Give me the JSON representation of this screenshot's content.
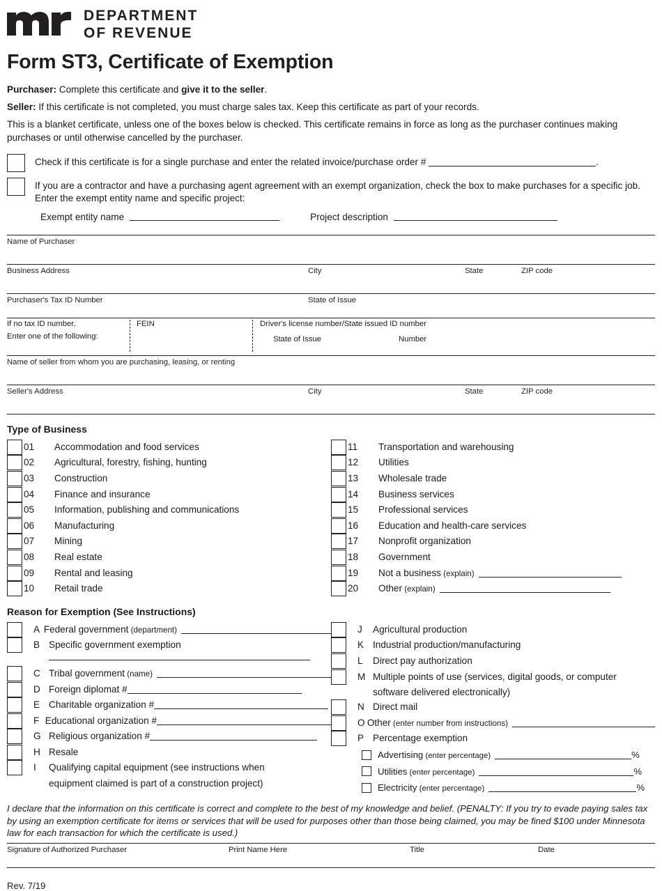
{
  "header": {
    "logo_icon": "mn-wordmark-logo",
    "dept_line1": "DEPARTMENT",
    "dept_line2": "OF REVENUE",
    "form_title": "Form ST3, Certificate of Exemption"
  },
  "intro": {
    "purchaser_label": "Purchaser:",
    "purchaser_text": " Complete this certificate and ",
    "purchaser_bold": "give it to the seller",
    "purchaser_end": ".",
    "seller_label": "Seller:",
    "seller_text": " If this certificate is not completed, you must charge sales tax. Keep this certificate as part of your records.",
    "blanket": "This is a blanket certificate, unless one of the boxes below is checked. This certificate remains in force as long as the purchaser continues making purchases or until otherwise cancelled by the purchaser."
  },
  "top_checks": {
    "single_purchase": "Check if this certificate is for a single purchase and enter the related invoice/purchase order #",
    "single_purchase_end": ".",
    "contractor": "If you are a contractor and have a purchasing agent agreement with an exempt organization, check the box to make purchases for a specific job. Enter the exempt entity name and specific project:",
    "exempt_entity_label": "Exempt entity name",
    "project_description_label": "Project description"
  },
  "fields": {
    "name_of_purchaser": "Name of Purchaser",
    "business_address": "Business Address",
    "city": "City",
    "state": "State",
    "zip_code": "ZIP code",
    "purchaser_tax_id": "Purchaser's Tax ID Number",
    "state_of_issue": "State of Issue",
    "if_no_tax_id_line1": "If no tax ID number,",
    "if_no_tax_id_line2": "Enter one of the following:",
    "fein": "FEIN",
    "drivers_license": "Driver's license number/State issued ID number",
    "dl_state_of_issue": "State of Issue",
    "dl_number": "Number",
    "name_of_seller": "Name of seller from whom you are purchasing, leasing, or renting",
    "sellers_address": "Seller's Address",
    "seller_city": "City",
    "seller_state": "State",
    "seller_zip": "ZIP code"
  },
  "type_of_business": {
    "heading": "Type of Business",
    "left": [
      {
        "num": "01",
        "label": "Accommodation and food services"
      },
      {
        "num": "02",
        "label": "Agricultural, forestry, fishing, hunting"
      },
      {
        "num": "03",
        "label": "Construction"
      },
      {
        "num": "04",
        "label": "Finance and insurance"
      },
      {
        "num": "05",
        "label": "Information, publishing and communications"
      },
      {
        "num": "06",
        "label": "Manufacturing"
      },
      {
        "num": "07",
        "label": "Mining"
      },
      {
        "num": "08",
        "label": "Real estate"
      },
      {
        "num": "09",
        "label": "Rental and leasing"
      },
      {
        "num": "10",
        "label": "Retail trade"
      }
    ],
    "right": [
      {
        "num": "11",
        "label": "Transportation and warehousing"
      },
      {
        "num": "12",
        "label": "Utilities"
      },
      {
        "num": "13",
        "label": "Wholesale trade"
      },
      {
        "num": "14",
        "label": "Business services"
      },
      {
        "num": "15",
        "label": "Professional services"
      },
      {
        "num": "16",
        "label": "Education and health-care services"
      },
      {
        "num": "17",
        "label": "Nonprofit organization"
      },
      {
        "num": "18",
        "label": "Government"
      },
      {
        "num": "19",
        "label": "Not a business",
        "paren": "(explain)",
        "line": true
      },
      {
        "num": "20",
        "label": "Other",
        "paren": "(explain)",
        "line": true
      }
    ]
  },
  "reason_for_exemption": {
    "heading": "Reason for Exemption (See Instructions)",
    "left": [
      {
        "ltr": "A",
        "label": "Federal government",
        "paren": "(department)",
        "line": true
      },
      {
        "ltr": "B",
        "label": "Specific government exemption"
      },
      {
        "ltr": "C",
        "label": "Tribal government",
        "paren": "(name)",
        "line": true
      },
      {
        "ltr": "D",
        "label": "Foreign diplomat #",
        "line": true
      },
      {
        "ltr": "E",
        "label": "Charitable organization #",
        "line": true
      },
      {
        "ltr": "F",
        "label": "Educational organization #",
        "line": true
      },
      {
        "ltr": "G",
        "label": "Religious organization #",
        "line": true
      },
      {
        "ltr": "H",
        "label": "Resale"
      },
      {
        "ltr": "I",
        "label": "Qualifying capital equipment (see instructions when",
        "cont": "equipment claimed is part of a construction project)"
      }
    ],
    "right": [
      {
        "ltr": "J",
        "label": "Agricultural production"
      },
      {
        "ltr": "K",
        "label": "Industrial production/manufacturing"
      },
      {
        "ltr": "L",
        "label": "Direct pay authorization"
      },
      {
        "ltr": "M",
        "label": "Multiple points of use (services, digital goods, or computer",
        "cont": "software delivered electronically)"
      },
      {
        "ltr": "N",
        "label": "Direct mail"
      },
      {
        "ltr": "O",
        "label": "Other",
        "paren": "(enter number from instructions)",
        "line": true
      },
      {
        "ltr": "P",
        "label": "Percentage exemption"
      }
    ],
    "percentages": [
      {
        "label": "Advertising",
        "paren": "(enter percentage)",
        "suffix": "%"
      },
      {
        "label": "Utilities",
        "paren": "(enter percentage)",
        "suffix": "%"
      },
      {
        "label": "Electricity",
        "paren": "(enter percentage)",
        "suffix": "%"
      }
    ]
  },
  "declaration": {
    "text": "I declare that the information on this certificate is correct and complete to the best of my knowledge and belief. (PENALTY: If you try to evade paying sales tax by using an exemption certificate for items or services that will be used for purposes other than those being claimed, you may be fined $100 under Minnesota law for each transaction for which the certificate is used.)",
    "signature_label": "Signature of Authorized Purchaser",
    "print_name_label": "Print Name Here",
    "title_label": "Title",
    "date_label": "Date"
  },
  "footer": {
    "revision": "Rev. 7/19"
  }
}
